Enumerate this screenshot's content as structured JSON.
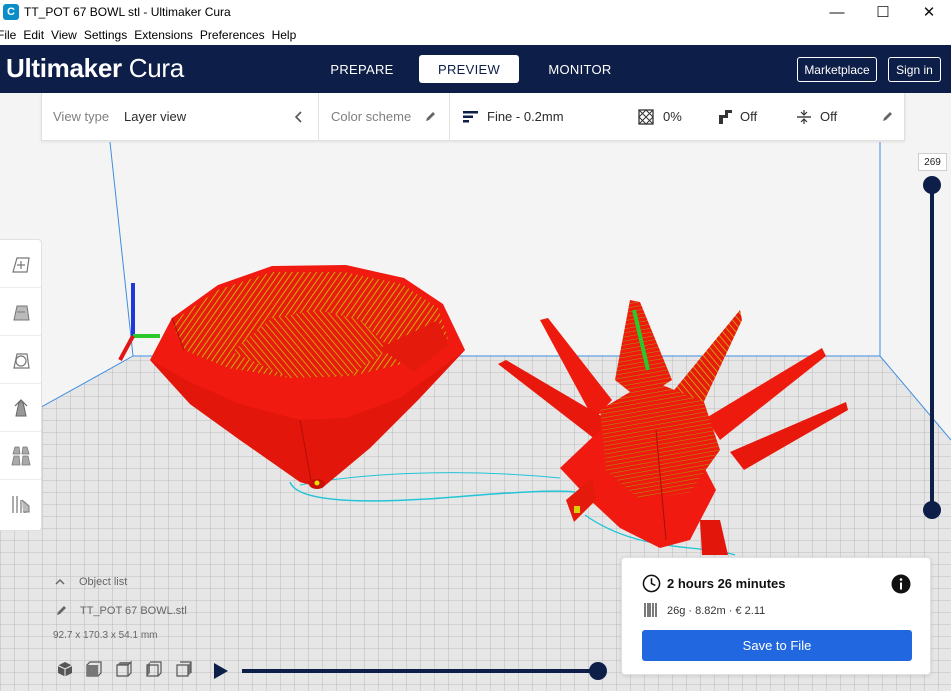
{
  "window": {
    "title": "TT_POT 67 BOWL stl - Ultimaker Cura",
    "icon_letter": "C",
    "minimize_glyph": "—",
    "maximize_glyph": "☐",
    "close_glyph": "✕"
  },
  "menu": [
    "File",
    "Edit",
    "View",
    "Settings",
    "Extensions",
    "Preferences",
    "Help"
  ],
  "header": {
    "brand_bold": "Ultimaker",
    "brand_light": " Cura",
    "stages": [
      "PREPARE",
      "PREVIEW",
      "MONITOR"
    ],
    "active_stage": "PREVIEW",
    "marketplace_label": "Marketplace",
    "signin_label": "Sign in"
  },
  "settings_bar": {
    "view_type_label": "View type",
    "view_type_value": "Layer view",
    "color_scheme_label": "Color scheme",
    "profile": "Fine - 0.2mm",
    "infill": "0%",
    "support": "Off",
    "adhesion": "Off"
  },
  "tools": [
    "move-tool-icon",
    "scale-tool-icon",
    "rotate-tool-icon",
    "mirror-tool-icon",
    "per-model-settings-icon",
    "support-blocker-icon"
  ],
  "layer_slider": {
    "current_layer": "269",
    "upper_fraction": 1.0,
    "lower_fraction": 0.0
  },
  "object_list": {
    "toggle_label": "Object list",
    "filename": "TT_POT 67 BOWL.stl",
    "dimensions": "92.7 x 170.3 x 54.1 mm"
  },
  "view_buttons": [
    "3d-view-icon",
    "front-view-icon",
    "top-view-icon",
    "left-view-icon",
    "right-view-icon"
  ],
  "simulation": {
    "progress_fraction": 1.0
  },
  "print_info": {
    "time": "2 hours 26 minutes",
    "material": "26g · 8.82m · € 2.11",
    "save_label": "Save to File"
  },
  "colors": {
    "header_bg": "#0d1e48",
    "accent_blue": "#2168e0",
    "model_red": "#f01a10",
    "infill_yellow": "#d2d400",
    "travel_cyan": "#1ec9d8"
  }
}
